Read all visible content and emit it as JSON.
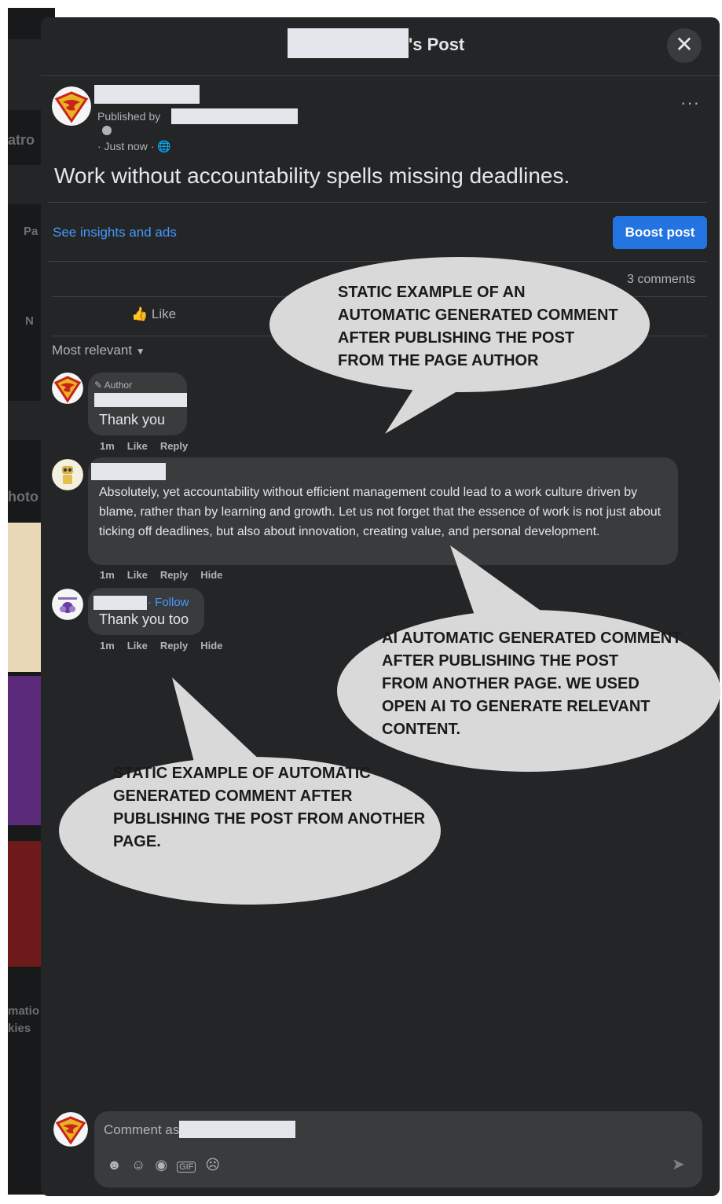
{
  "dialog": {
    "title_suffix": "'s Post",
    "close_label": "✕"
  },
  "background": {
    "fragments": [
      "atro",
      "Pa",
      "N",
      "hoto",
      "matio",
      "kies"
    ]
  },
  "post": {
    "published_by_label": "Published by",
    "timestamp": "· Just now · ",
    "privacy_icon": "globe-icon",
    "text": "Work without accountability spells missing deadlines.",
    "more_label": "···",
    "insights_link": "See insights and ads",
    "boost_button": "Boost post",
    "comments_count": "3 comments",
    "like_label": "Like",
    "sort_label": "Most relevant"
  },
  "comments": [
    {
      "badge": "Author",
      "text": "Thank you",
      "time": "1m",
      "actions": [
        "Like",
        "Reply"
      ]
    },
    {
      "text": "Absolutely, yet accountability without efficient management could lead to a work culture driven by blame, rather than by learning and growth. Let us not forget that the essence of work is not just about ticking off deadlines, but also about innovation, creating value, and personal development.",
      "time": "1m",
      "actions": [
        "Like",
        "Reply",
        "Hide"
      ]
    },
    {
      "follow_label": "· Follow",
      "text": "Thank you too",
      "time": "1m",
      "actions": [
        "Like",
        "Reply",
        "Hide"
      ]
    }
  ],
  "callouts": [
    {
      "lines": [
        "STATIC EXAMPLE OF AN",
        "AUTOMATIC GENERATED COMMENT",
        "AFTER PUBLISHING THE POST",
        "FROM THE PAGE AUTHOR"
      ]
    },
    {
      "lines": [
        "AI AUTOMATIC GENERATED COMMENT",
        "AFTER PUBLISHING THE POST",
        "FROM ANOTHER PAGE. WE USED",
        "OPEN AI TO GENERATE RELEVANT",
        "CONTENT."
      ]
    },
    {
      "lines": [
        "STATIC EXAMPLE OF AUTOMATIC",
        "GENERATED COMMENT AFTER",
        "PUBLISHING THE POST FROM ANOTHER",
        "PAGE."
      ]
    }
  ],
  "composer": {
    "placeholder": "Comment as",
    "icons": [
      "avatar-sticker-icon",
      "emoji-icon",
      "camera-icon",
      "gif-icon",
      "sticker-icon"
    ],
    "send_icon": "send-icon"
  },
  "colors": {
    "modal_bg": "#242526",
    "bubble_bg": "#3a3b3c",
    "link": "#4599ff",
    "boost": "#2374e1",
    "callout_fill": "#d9d9d9"
  }
}
